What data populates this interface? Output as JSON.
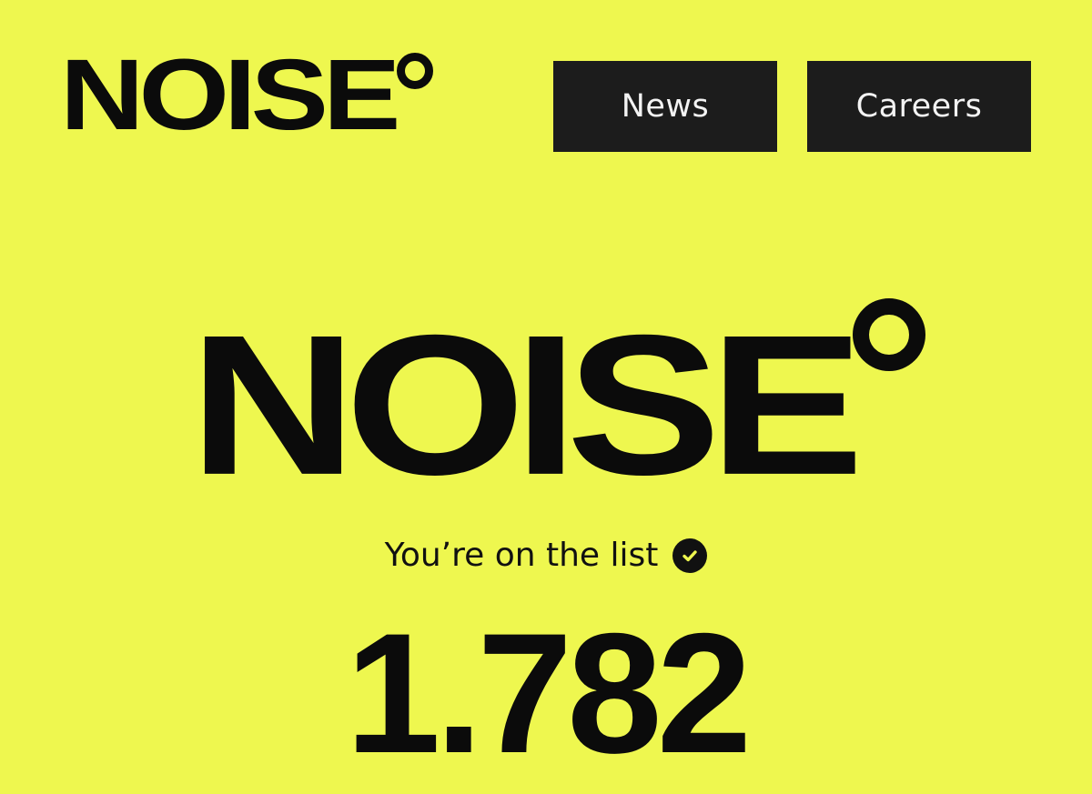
{
  "brand": {
    "name": "NOISE"
  },
  "nav": {
    "news_label": "News",
    "careers_label": "Careers"
  },
  "hero": {
    "logo_text": "NOISE",
    "status_text": "You’re on the list",
    "status_icon": "check-circle-icon",
    "count": "1.782"
  },
  "colors": {
    "background": "#eef74f",
    "button": "#1c1c1c",
    "text": "#0b0b0b"
  }
}
